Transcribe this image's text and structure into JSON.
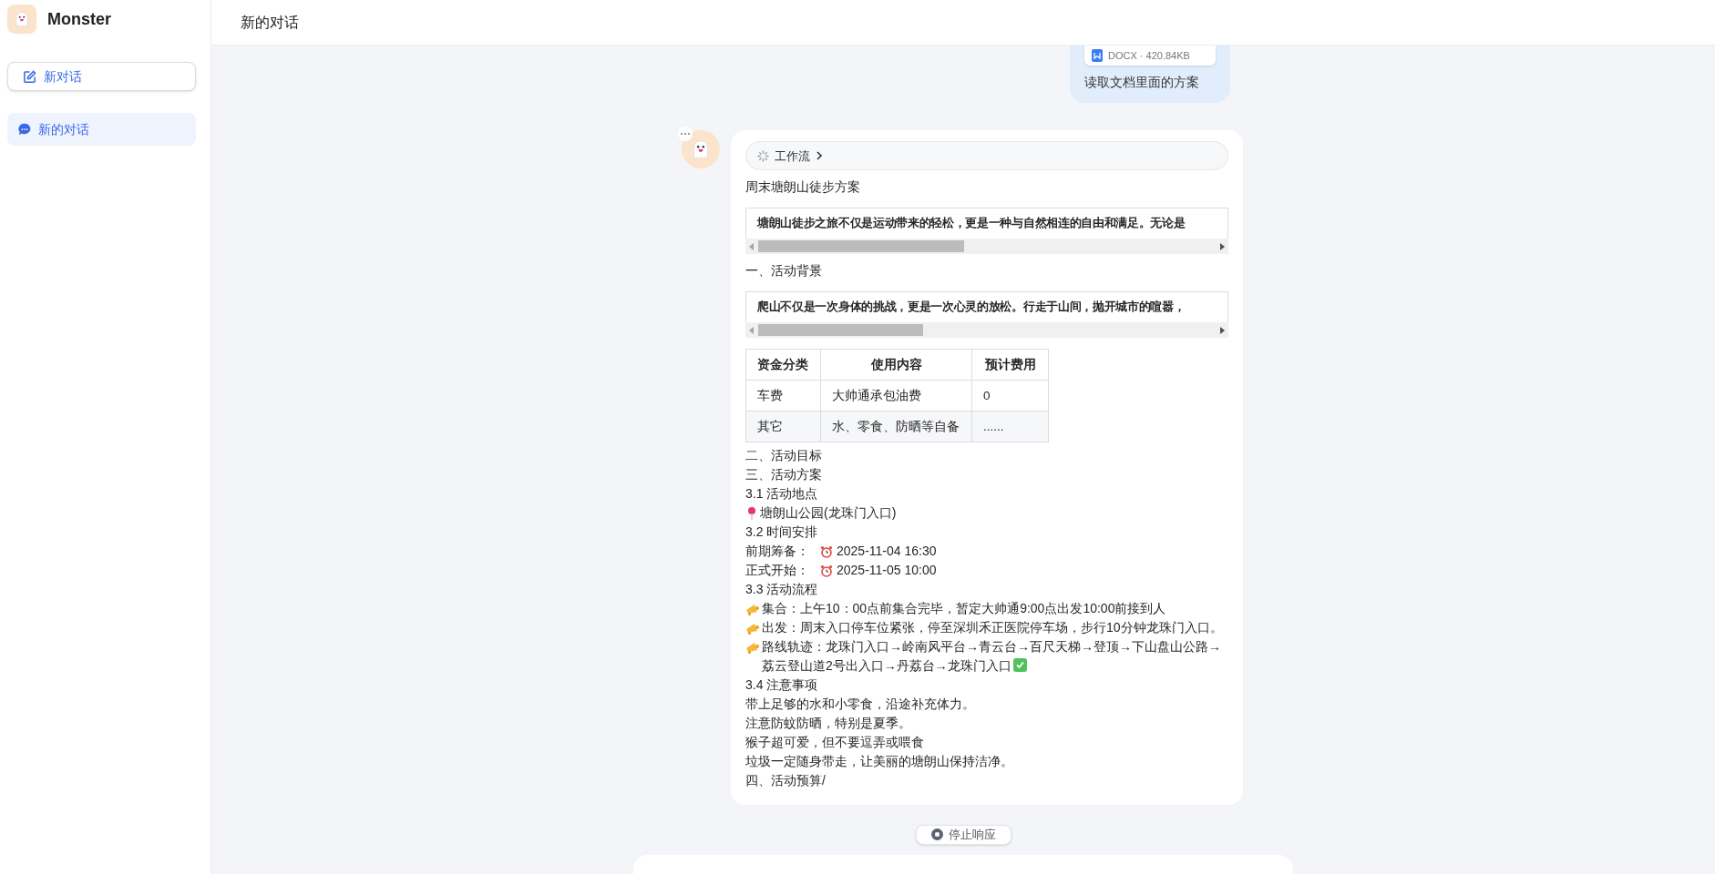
{
  "sidebar": {
    "app_name": "Monster",
    "new_chat_button": "新对话",
    "conversations": [
      {
        "title": "新的对话",
        "selected": true
      }
    ]
  },
  "header": {
    "title": "新的对话"
  },
  "user_message": {
    "file": {
      "meta": "DOCX · 420.84KB"
    },
    "text": "读取文档里面的方案"
  },
  "assistant_message": {
    "workflow": {
      "label": "工作流"
    },
    "title": "周末塘朗山徒步方案",
    "blocks": [
      {
        "kind": "scroll_text",
        "text": "塘朗山徒步之旅不仅是运动带来的轻松，更是一种与自然相连的自由和满足。无论是"
      },
      {
        "kind": "heading",
        "text": "一、活动背景"
      },
      {
        "kind": "scroll_text",
        "text": "爬山不仅是一次身体的挑战，更是一次心灵的放松。行走于山间，抛开城市的喧嚣，"
      },
      {
        "kind": "table",
        "columns": [
          "资金分类",
          "使用内容",
          "预计费用"
        ],
        "rows": [
          [
            "车费",
            "大帅通承包油费",
            "0"
          ],
          [
            "其它",
            "水、零食、防晒等自备",
            "......"
          ]
        ]
      }
    ],
    "lines": [
      {
        "kind": "plain",
        "text": "二、活动目标"
      },
      {
        "kind": "plain",
        "text": "三、活动方案"
      },
      {
        "kind": "plain",
        "text": "3.1 活动地点"
      },
      {
        "kind": "location",
        "text": "塘朗山公园(龙珠门入口)"
      },
      {
        "kind": "plain",
        "text": "3.2 时间安排"
      },
      {
        "kind": "schedule",
        "label": "前期筹备：",
        "text": "2025-11-04 16:30"
      },
      {
        "kind": "schedule",
        "label": "正式开始：",
        "text": "2025-11-05 10:00"
      },
      {
        "kind": "plain",
        "text": "3.3 活动流程"
      },
      {
        "kind": "step",
        "text": "集合：上午10：00点前集合完毕，暂定大帅通9:00点出发10:00前接到人"
      },
      {
        "kind": "step",
        "text": "出发：周末入口停车位紧张，停至深圳禾正医院停车场，步行10分钟龙珠门入口。"
      },
      {
        "kind": "route",
        "text": "路线轨迹：龙珠门入口→岭南风平台→青云台→百尺天梯→登顶→下山盘山公路→荔云登山道2号出入口→丹荔台→龙珠门入口"
      },
      {
        "kind": "plain",
        "text": "3.4 注意事项"
      },
      {
        "kind": "plain",
        "text": "带上足够的水和小零食，沿途补充体力。"
      },
      {
        "kind": "plain",
        "text": "注意防蚊防晒，特别是夏季。"
      },
      {
        "kind": "plain",
        "text": "猴子超可爱，但不要逗弄或喂食"
      },
      {
        "kind": "plain",
        "text": "垃圾一定随身带走，让美丽的塘朗山保持洁净。"
      },
      {
        "kind": "plain",
        "text": "四、活动预算/"
      }
    ]
  },
  "stop_button": "停止响应"
}
